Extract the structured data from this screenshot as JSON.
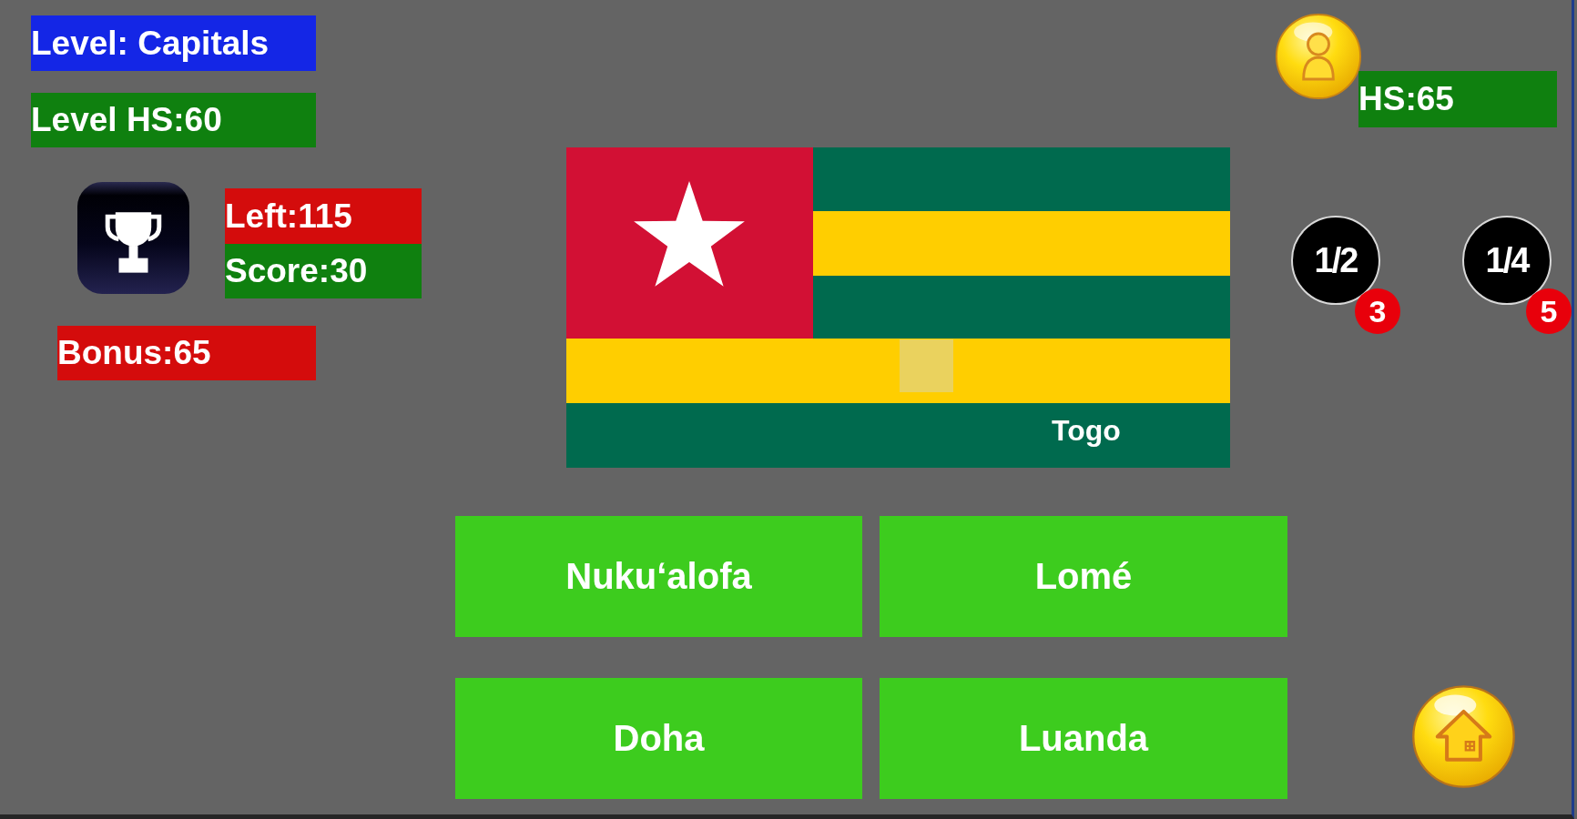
{
  "hud": {
    "level": "Level: Capitals",
    "level_high_score": "Level HS:60",
    "left": "Left:115",
    "score": "Score:30",
    "bonus": "Bonus:65"
  },
  "player": {
    "high_score": "HS:65"
  },
  "question": {
    "flag_caption": "Togo"
  },
  "answers": [
    "Nukuʻalofa",
    "Lomé",
    "Doha",
    "Luanda"
  ],
  "lifelines": [
    {
      "label": "1/2",
      "count": "3"
    },
    {
      "label": "1/4",
      "count": "5"
    }
  ]
}
